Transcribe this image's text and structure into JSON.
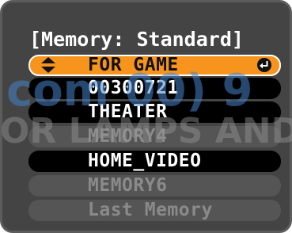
{
  "menu": {
    "title": "[Memory: Standard]",
    "items": [
      {
        "label": "FOR GAME",
        "state": "selected"
      },
      {
        "label": "00300721",
        "state": "active"
      },
      {
        "label": "THEATER",
        "state": "active"
      },
      {
        "label": "MEMORY4",
        "state": "disabled"
      },
      {
        "label": "HOME_VIDEO",
        "state": "active"
      },
      {
        "label": "MEMORY6",
        "state": "disabled"
      },
      {
        "label": "Last Memory",
        "state": "disabled"
      }
    ]
  },
  "watermark": {
    "line1": "com 00) 9",
    "line2": "OR LAMPS AND A"
  },
  "colors": {
    "panel": "#444444",
    "selected": "#f7941d",
    "active": "#000000",
    "disabled": "#555555"
  },
  "icons": {
    "navigate": "updown-arrows-icon",
    "confirm": "enter-icon"
  }
}
